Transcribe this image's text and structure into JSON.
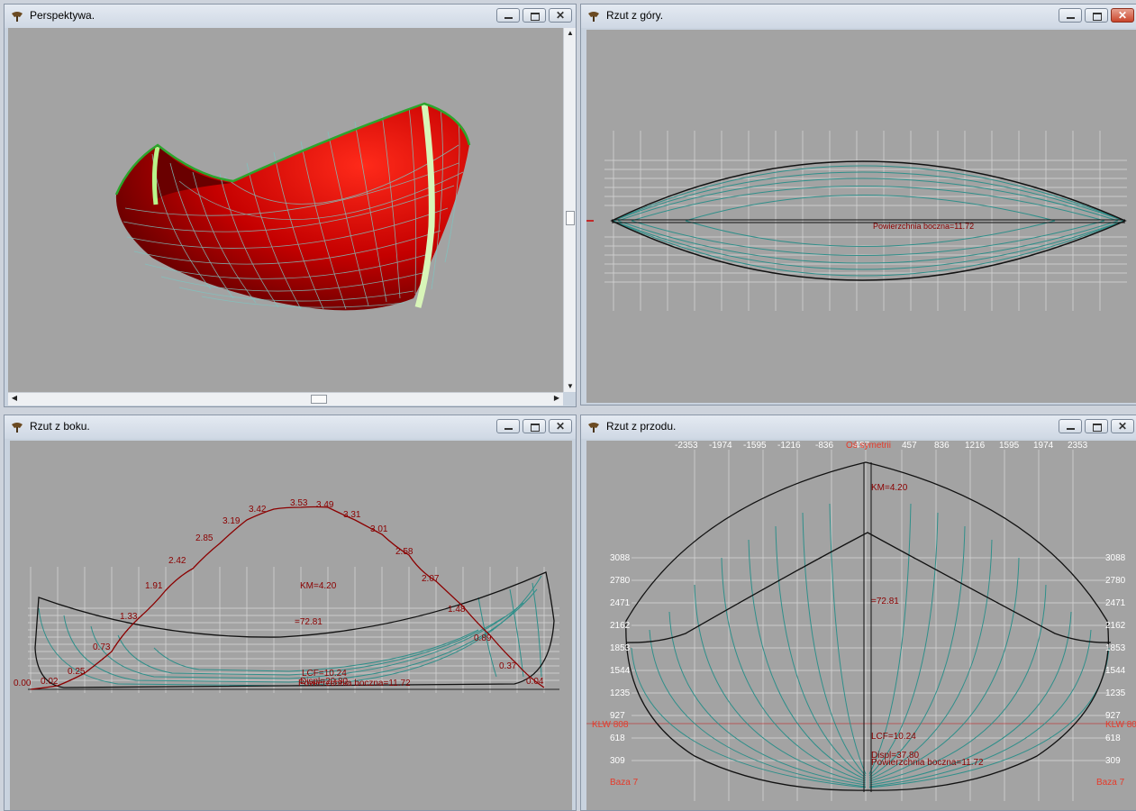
{
  "windows": {
    "perspective": {
      "title": "Perspektywa."
    },
    "top": {
      "title": "Rzut z góry.",
      "overlay": "Powierzchnia boczna=11.72"
    },
    "side": {
      "title": "Rzut z boku.",
      "km": "KM=4.20",
      "value": "=72.81",
      "lcf": "LCF=10.24",
      "displ": "Displ=20.80",
      "area": "Powierzchnia boczna=11.72",
      "curve_labels": [
        "0.00",
        "0.02",
        "0.25",
        "0.73",
        "1.33",
        "1.91",
        "2.42",
        "2.85",
        "3.19",
        "3.42",
        "3.53",
        "3.49",
        "3.31",
        "3.01",
        "2.58",
        "2.07",
        "1.48",
        "0.89",
        "0.37",
        "0.04"
      ]
    },
    "front": {
      "title": "Rzut z przodu.",
      "top_ticks_left": [
        "-2353",
        "-1974",
        "-1595",
        "-1216",
        "-836",
        "-457"
      ],
      "axis_label": "Oś symetrii",
      "top_ticks_right": [
        "457",
        "836",
        "1216",
        "1595",
        "1974",
        "2353"
      ],
      "y_ticks": [
        "3088",
        "2780",
        "2471",
        "2162",
        "1853",
        "1544",
        "1235",
        "927",
        "618",
        "309"
      ],
      "klw": "KLW 808",
      "baza": "Baza 7",
      "km": "KM=4.20",
      "value": "=72.81",
      "lcf": "LCF=10.24",
      "displ": "Displ=37.80",
      "area": "Powierzchnia boczna=11.72"
    }
  },
  "colors": {
    "canvas": "#a3a3a3",
    "hull": "#b30000",
    "station": "#2f8f8a",
    "label_red": "#8b0000"
  }
}
